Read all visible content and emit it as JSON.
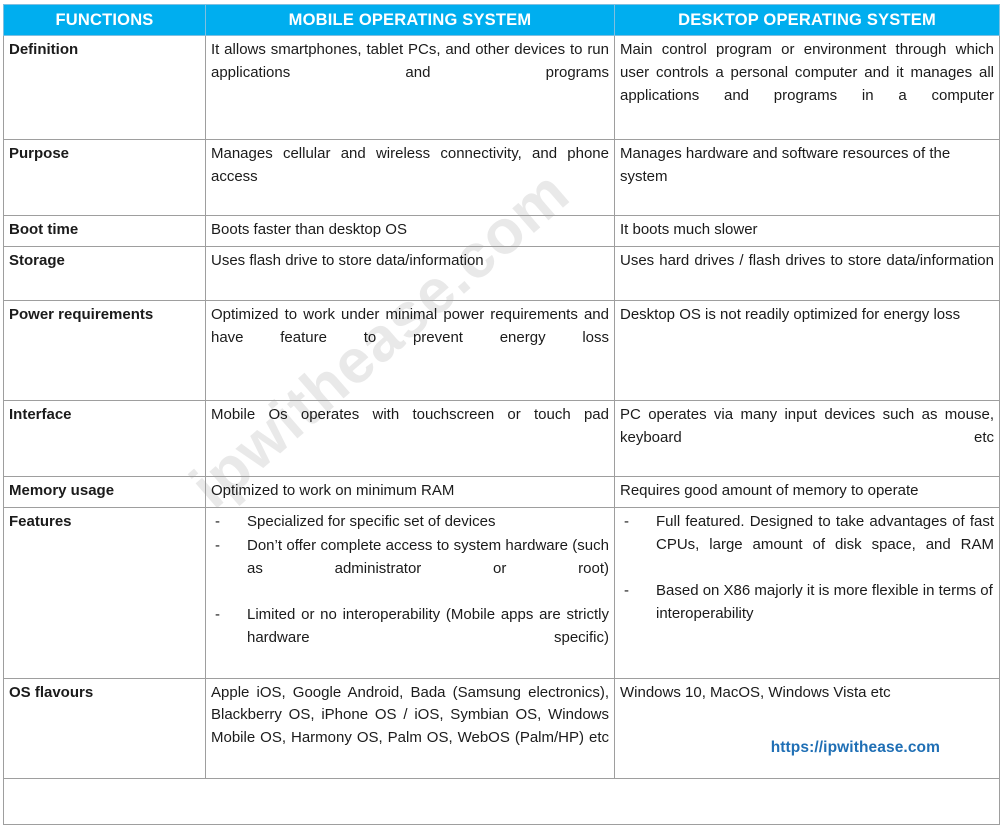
{
  "watermark": {
    "text": "ipwithease.com"
  },
  "footer": {
    "url": "https://ipwithease.com"
  },
  "colors": {
    "header_bg": "#00AEEF",
    "header_text": "#FFFFFF",
    "border": "#9E9E9E",
    "body_text": "#1B1B1B",
    "footer_link": "#1F6FB5",
    "watermark": "#E9E9E9"
  },
  "table": {
    "headers": [
      "FUNCTIONS",
      "MOBILE OPERATING SYSTEM",
      "DESKTOP OPERATING SYSTEM"
    ],
    "rows": [
      {
        "function": "Definition",
        "mobile": "It allows smartphones, tablet PCs, and other devices to run applications and programs",
        "desktop": "Main control program or environment through which user controls a personal computer and it manages all applications and programs in a computer"
      },
      {
        "function": "Purpose",
        "mobile": "Manages cellular and wireless connectivity, and phone access",
        "desktop": "Manages hardware and software resources of the system"
      },
      {
        "function": "Boot time",
        "mobile": "Boots faster than desktop OS",
        "desktop": "It boots much slower"
      },
      {
        "function": "Storage",
        "mobile": "Uses flash drive to store data/information",
        "desktop": "Uses hard drives / flash drives to store data/information"
      },
      {
        "function": "Power requirements",
        "mobile": "Optimized to work under minimal power requirements and have feature to prevent energy loss",
        "desktop": "Desktop OS is not readily optimized for energy loss"
      },
      {
        "function": "Interface",
        "mobile": "Mobile Os operates with touchscreen or touch pad",
        "desktop": "PC operates via many input devices such as mouse, keyboard etc"
      },
      {
        "function": "Memory usage",
        "mobile": "Optimized to work on minimum RAM",
        "desktop": "Requires good amount of memory to operate"
      },
      {
        "function": "Features",
        "mobile_bullets": [
          "Specialized for specific set of devices",
          "Don’t offer complete access to system hardware (such as administrator or root)",
          "Limited or no interoperability (Mobile apps are strictly hardware specific)"
        ],
        "desktop_bullets": [
          "Full featured. Designed to take advantages of fast CPUs, large amount of disk space, and RAM",
          "Based on X86 majorly it is more flexible in terms of interoperability"
        ]
      },
      {
        "function": "OS flavours",
        "mobile": "Apple iOS, Google Android, Bada (Samsung electronics), Blackberry OS, iPhone OS / iOS, Symbian OS, Windows Mobile OS, Harmony OS, Palm OS, WebOS (Palm/HP) etc",
        "desktop": "Windows 10, MacOS, Windows Vista etc"
      }
    ]
  }
}
